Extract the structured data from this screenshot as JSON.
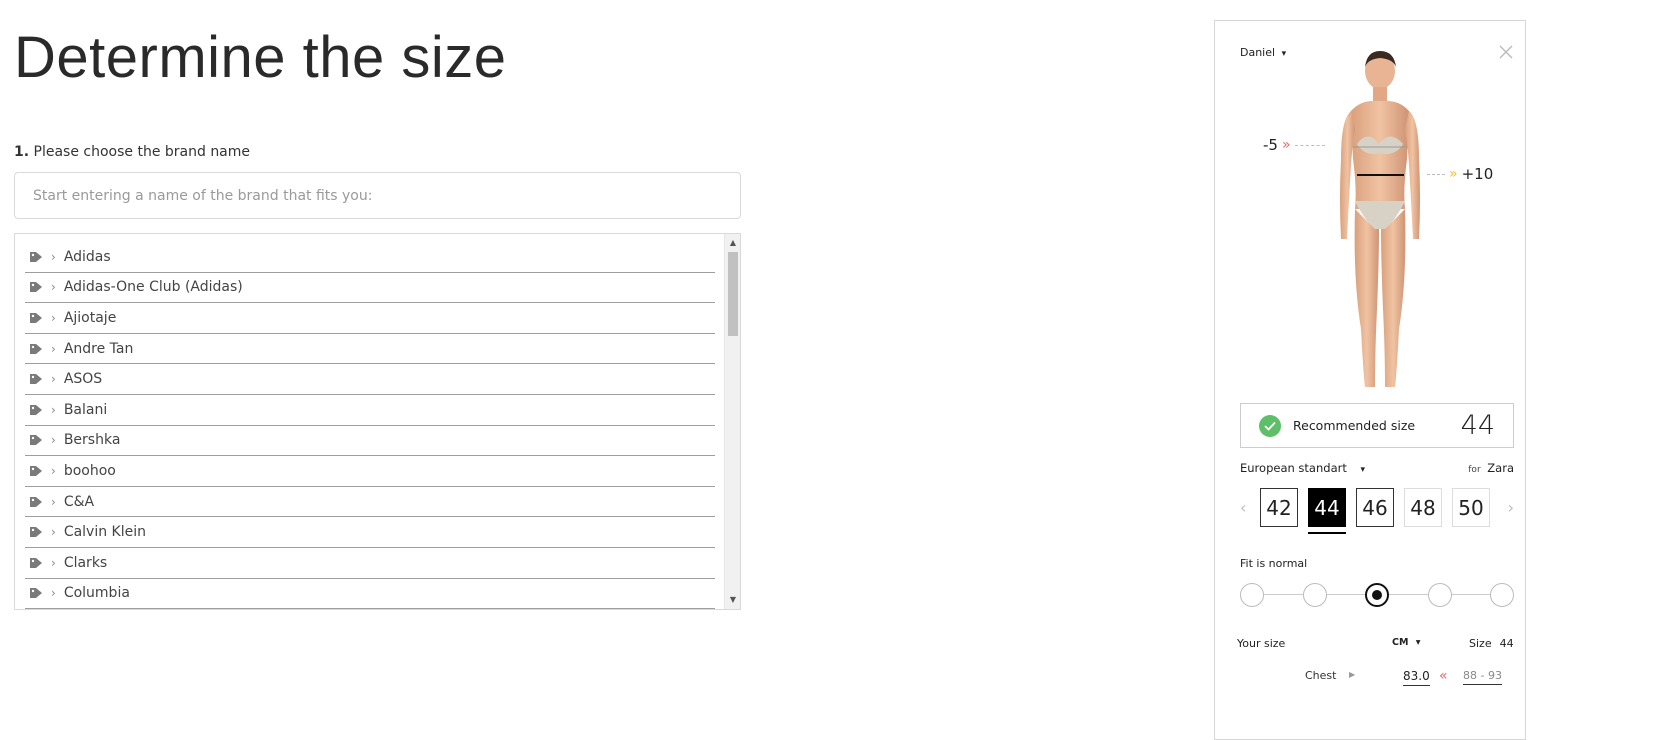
{
  "page": {
    "title": "Determine the size",
    "step_number": "1.",
    "step_label": "Please choose the brand name"
  },
  "search": {
    "placeholder": "Start entering a name of the brand that fits you:",
    "value": ""
  },
  "brands": [
    "Adidas",
    "Adidas-One Club (Adidas)",
    "Ajiotaje",
    "Andre Tan",
    "ASOS",
    "Balani",
    "Bershka",
    "boohoo",
    "C&A",
    "Calvin Klein",
    "Clarks",
    "Columbia"
  ],
  "widget": {
    "profile_name": "Daniel",
    "measure_left": "-5",
    "measure_right": "+10",
    "recommended_label": "Recommended size",
    "recommended_value": "44",
    "standard": "European standart",
    "for_label": "for",
    "for_brand": "Zara",
    "sizes": [
      "42",
      "44",
      "46",
      "48",
      "50"
    ],
    "selected_size": "44",
    "fit_label": "Fit is normal",
    "fit_level": 3,
    "fit_levels": 5,
    "your_size_label": "Your size",
    "unit": "CM",
    "size_label": "Size",
    "size_value": "44",
    "chest_label": "Chest",
    "chest_value": "83.0",
    "chest_range": "88 - 93"
  },
  "colors": {
    "check": "#5dbf67",
    "arrow_minus": "#e06a6a",
    "arrow_plus": "#e7c230"
  }
}
